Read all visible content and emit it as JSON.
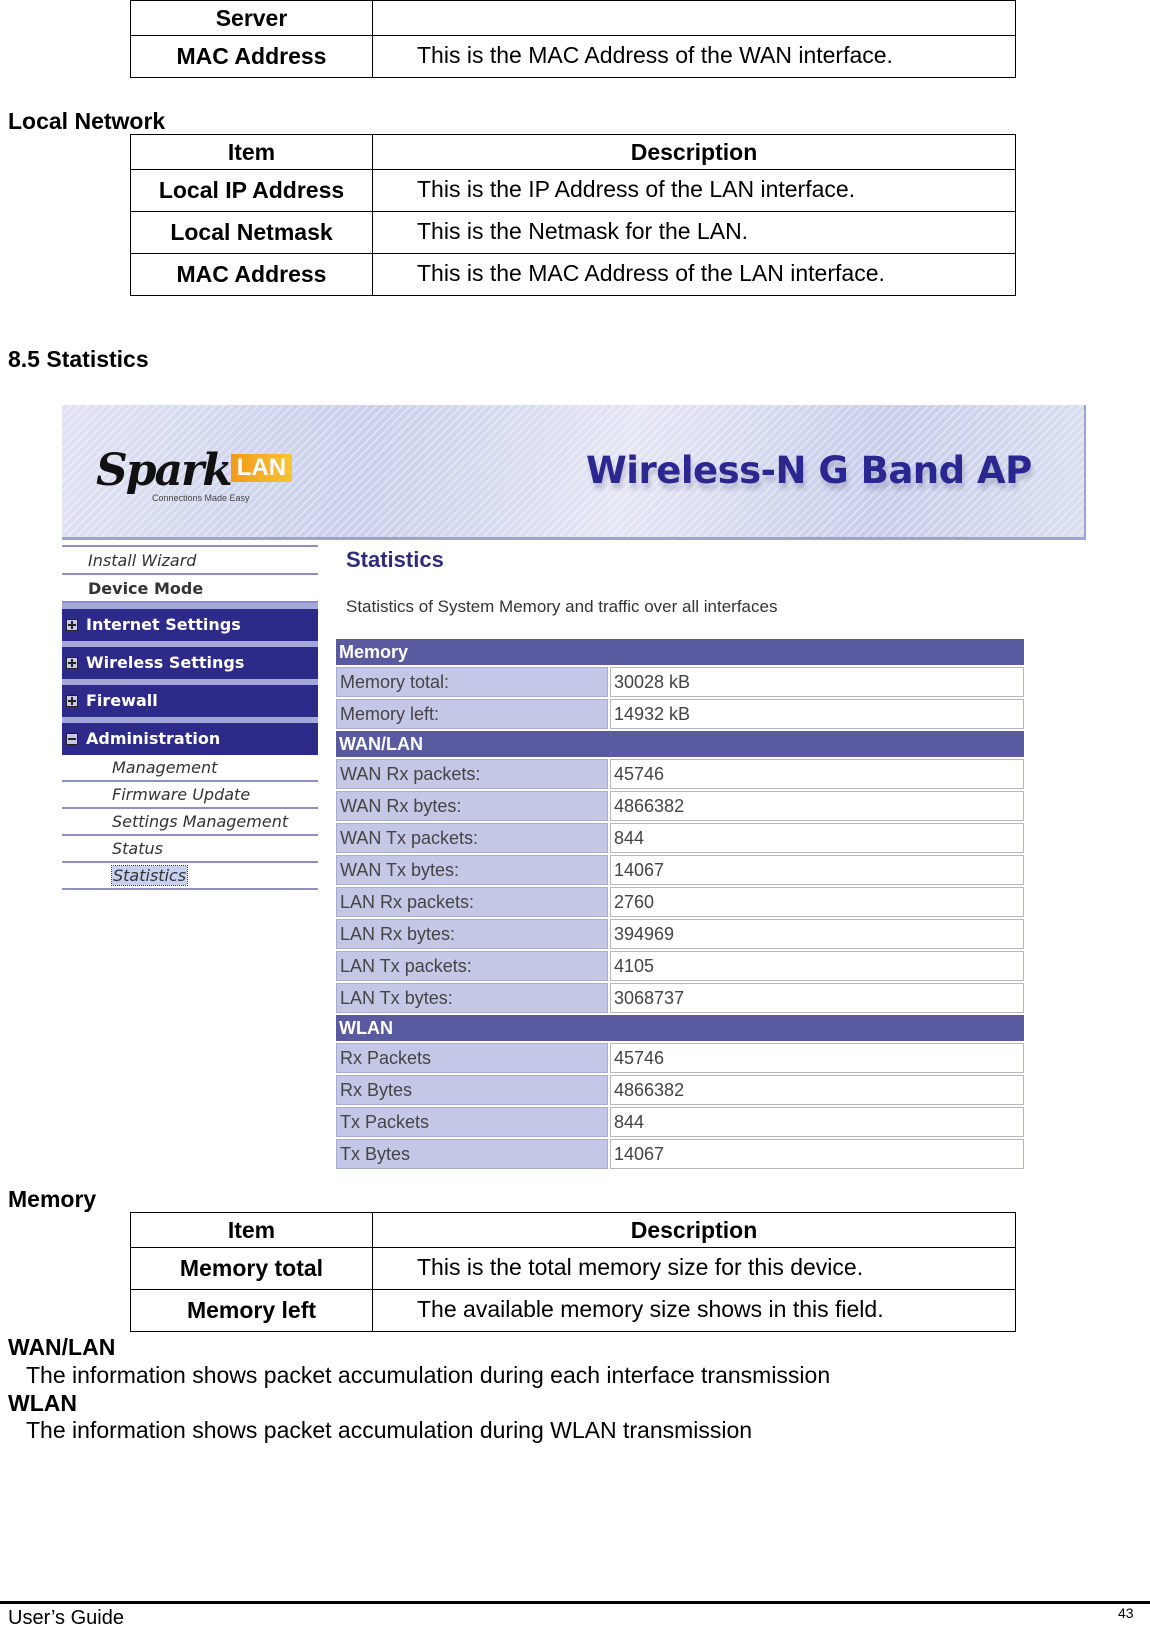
{
  "top_table": {
    "rows": [
      {
        "item": "Server",
        "description": ""
      },
      {
        "item": "MAC Address",
        "description": "This is the MAC Address of the WAN interface."
      }
    ]
  },
  "local_network": {
    "title": "Local Network",
    "header": {
      "item": "Item",
      "description": "Description"
    },
    "rows": [
      {
        "item": "Local IP Address",
        "description": "This is the IP Address of the LAN interface."
      },
      {
        "item": "Local Netmask",
        "description": "This is the Netmask for the LAN."
      },
      {
        "item": "MAC Address",
        "description": "This is the MAC Address of the LAN interface."
      }
    ]
  },
  "section_heading": "8.5 Statistics",
  "screenshot": {
    "brand": {
      "name": "Spark",
      "suffix": "LAN",
      "tagline": "Connections Made Easy"
    },
    "banner_title": "Wireless-N G Band AP",
    "sidebar": {
      "top_items": [
        {
          "label": "Install Wizard"
        },
        {
          "label": "Device Mode"
        }
      ],
      "categories": [
        {
          "label": "Internet Settings",
          "expanded": false
        },
        {
          "label": "Wireless Settings",
          "expanded": false
        },
        {
          "label": "Firewall",
          "expanded": false
        },
        {
          "label": "Administration",
          "expanded": true
        }
      ],
      "admin_items": [
        {
          "label": "Management"
        },
        {
          "label": "Firmware Update"
        },
        {
          "label": "Settings Management"
        },
        {
          "label": "Status"
        },
        {
          "label": "Statistics",
          "active": true
        }
      ]
    },
    "content": {
      "title": "Statistics",
      "description": "Statistics of System Memory and traffic over all interfaces",
      "groups": [
        {
          "name": "Memory",
          "rows": [
            {
              "label": "Memory total:",
              "value": "30028 kB"
            },
            {
              "label": "Memory left:",
              "value": "14932 kB"
            }
          ]
        },
        {
          "name": "WAN/LAN",
          "rows": [
            {
              "label": "WAN Rx packets:",
              "value": "45746"
            },
            {
              "label": "WAN Rx bytes:",
              "value": "4866382"
            },
            {
              "label": "WAN Tx packets:",
              "value": "844"
            },
            {
              "label": "WAN Tx bytes:",
              "value": "14067"
            },
            {
              "label": "LAN Rx packets:",
              "value": "2760"
            },
            {
              "label": "LAN Rx bytes:",
              "value": "394969"
            },
            {
              "label": "LAN Tx packets:",
              "value": "4105"
            },
            {
              "label": "LAN Tx bytes:",
              "value": "3068737"
            }
          ]
        },
        {
          "name": "WLAN",
          "rows": [
            {
              "label": "Rx Packets",
              "value": "45746"
            },
            {
              "label": "Rx Bytes",
              "value": "4866382"
            },
            {
              "label": "Tx Packets",
              "value": "844"
            },
            {
              "label": "Tx Bytes",
              "value": "14067"
            }
          ]
        }
      ]
    }
  },
  "memory_section": {
    "title": "Memory",
    "header": {
      "item": "Item",
      "description": "Description"
    },
    "rows": [
      {
        "item": "Memory total",
        "description": "This is the total memory size for this device."
      },
      {
        "item": "Memory left",
        "description": "The available memory size shows in this field."
      }
    ]
  },
  "wanlan_section": {
    "title": "WAN/LAN",
    "text": "The information shows packet accumulation during each interface transmission"
  },
  "wlan_section": {
    "title": "WLAN",
    "text": "The information shows packet accumulation during WLAN transmission"
  },
  "footer": {
    "left": "User’s Guide",
    "page": "43"
  }
}
